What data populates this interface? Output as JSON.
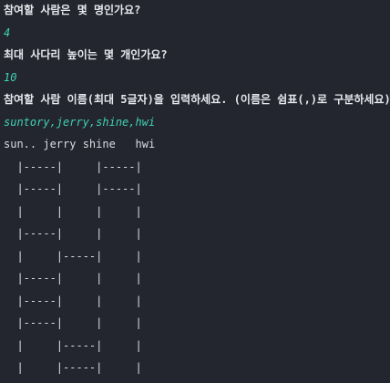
{
  "colors": {
    "background": "#23262e",
    "prompt_text": "#e6e8ee",
    "answer_text": "#3fd1b5",
    "output_text": "#d9dce3"
  },
  "prompts": {
    "participants_question": "참여할 사람은 몇 명인가요?",
    "participants_answer": "4",
    "height_question": "최대 사다리 높이는 몇 개인가요?",
    "height_answer": "10",
    "names_question": "참여할 사람 이름(최대 5글자)을 입력하세요. (이름은 쉼표(,)로 구분하세요)",
    "names_answer": "suntory,jerry,shine,hwi"
  },
  "ladder": {
    "header": "sun.. jerry shine   hwi",
    "rows": [
      "  |-----|     |-----|",
      "  |-----|     |-----|",
      "  |     |     |     |",
      "  |-----|     |     |",
      "  |     |-----|     |",
      "  |-----|     |     |",
      "  |-----|     |     |",
      "  |-----|     |     |",
      "  |     |-----|     |",
      "  |     |-----|     |"
    ]
  }
}
